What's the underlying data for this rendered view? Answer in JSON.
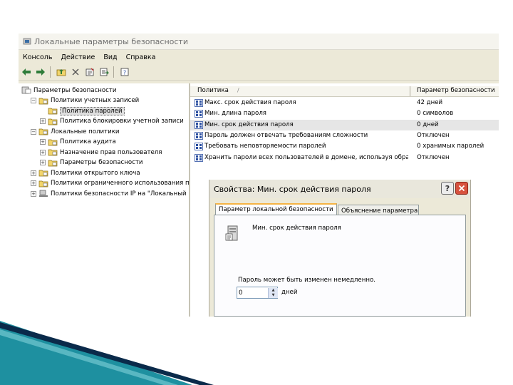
{
  "window": {
    "title": "Локальные параметры безопасности",
    "menu": [
      "Консоль",
      "Действие",
      "Вид",
      "Справка"
    ]
  },
  "toolbar": {
    "icons": [
      "back-icon",
      "forward-icon",
      "up-folder-icon",
      "delete-icon",
      "properties-icon",
      "export-list-icon",
      "help-icon"
    ]
  },
  "tree": {
    "items": [
      {
        "label": "Параметры безопасности",
        "level": 0,
        "expander": "none",
        "icon": "root"
      },
      {
        "label": "Политики учетных записей",
        "level": 1,
        "expander": "minus",
        "icon": "folder"
      },
      {
        "label": "Политика паролей",
        "level": 2,
        "expander": "none",
        "icon": "folder",
        "selected": true
      },
      {
        "label": "Политика блокировки учетной записи",
        "level": 2,
        "expander": "plus",
        "icon": "folder"
      },
      {
        "label": "Локальные политики",
        "level": 1,
        "expander": "minus",
        "icon": "folder"
      },
      {
        "label": "Политика аудита",
        "level": 2,
        "expander": "plus",
        "icon": "folder"
      },
      {
        "label": "Назначение прав пользователя",
        "level": 2,
        "expander": "plus",
        "icon": "folder"
      },
      {
        "label": "Параметры безопасности",
        "level": 2,
        "expander": "plus",
        "icon": "folder"
      },
      {
        "label": "Политики открытого ключа",
        "level": 1,
        "expander": "plus",
        "icon": "folder"
      },
      {
        "label": "Политики ограниченного использования программ",
        "level": 1,
        "expander": "plus",
        "icon": "folder"
      },
      {
        "label": "Политики безопасности IP на \"Локальный компьютер\"",
        "level": 1,
        "expander": "plus",
        "icon": "network"
      }
    ]
  },
  "list": {
    "columns": [
      "Политика",
      "Параметр безопасности"
    ],
    "rows": [
      {
        "policy": "Макс. срок действия пароля",
        "value": "42 дней"
      },
      {
        "policy": "Мин. длина пароля",
        "value": "0 символов"
      },
      {
        "policy": "Мин. срок действия пароля",
        "value": "0 дней",
        "highlighted": true
      },
      {
        "policy": "Пароль должен отвечать требованиям сложности",
        "value": "Отключен"
      },
      {
        "policy": "Требовать неповторяемости паролей",
        "value": "0 хранимых паролей"
      },
      {
        "policy": "Хранить пароли всех пользователей в домене, используя обратимое шифрование",
        "value": "Отключен"
      }
    ]
  },
  "dialog": {
    "title": "Свойства: Мин. срок действия пароля",
    "help_button": "?",
    "tabs": [
      "Параметр локальной безопасности",
      "Объяснение параметра"
    ],
    "policy_name": "Мин. срок действия пароля",
    "change_label": "Пароль может быть изменен немедленно.",
    "days_value": "0",
    "days_unit": "дней"
  },
  "colors": {
    "window_bg": "#ece9d8",
    "tab_active_accent": "#f5b445",
    "close_button": "#d7523e",
    "deco_teal": "#1e90a0",
    "deco_navy": "#0a2a4a"
  }
}
